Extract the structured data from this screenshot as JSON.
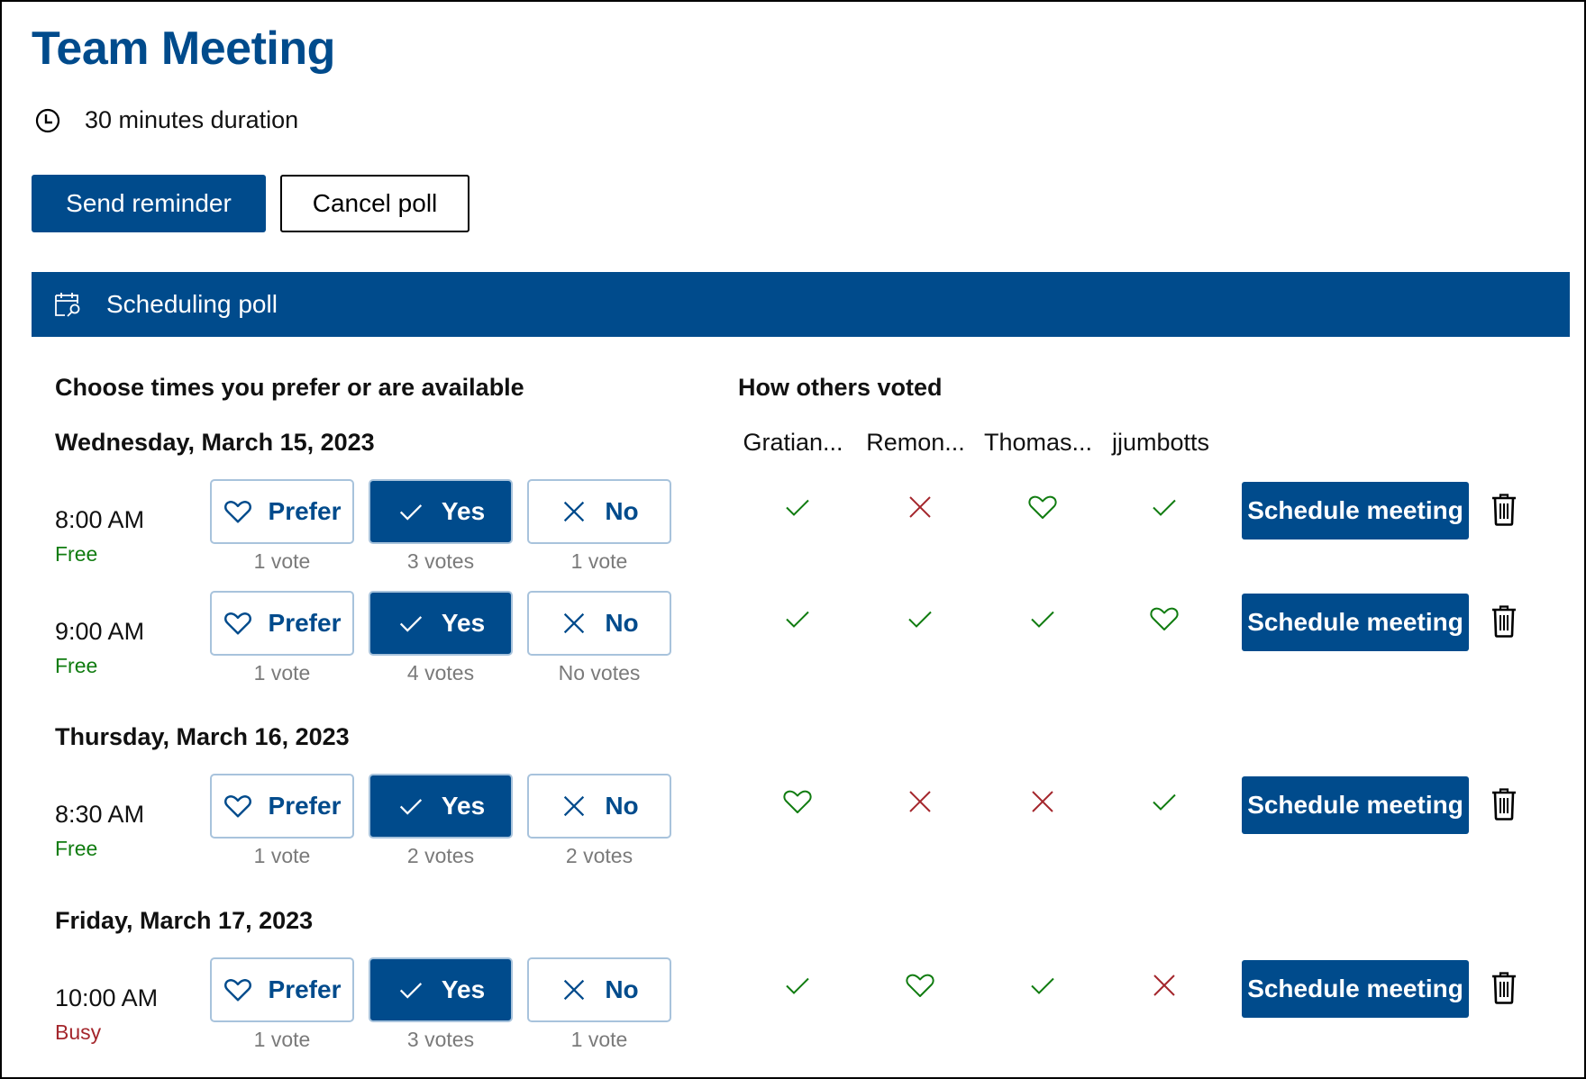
{
  "header": {
    "title": "Team Meeting",
    "duration": "30 minutes duration",
    "duration_icon": "clock-icon"
  },
  "actions": {
    "send_reminder": "Send reminder",
    "cancel_poll": "Cancel poll"
  },
  "banner": {
    "icon": "calendar-search-icon",
    "label": "Scheduling poll"
  },
  "left_heading": "Choose times you prefer or are available",
  "right_heading": "How others voted",
  "participants": [
    "Gratian...",
    "Remon...",
    "Thomas...",
    "jjumbotts"
  ],
  "labels": {
    "prefer": "Prefer",
    "yes": "Yes",
    "no": "No",
    "schedule": "Schedule meeting"
  },
  "colors": {
    "brand": "#004b8c",
    "free": "#107c10",
    "busy": "#a4262c",
    "vote_yes": "#107c10",
    "vote_prefer": "#107c10",
    "vote_no": "#a4262c"
  },
  "dates": [
    {
      "label": "Wednesday, March 15, 2023",
      "slots": [
        {
          "time": "8:00 AM",
          "status": "Free",
          "selected": "yes",
          "counts": {
            "prefer": "1 vote",
            "yes": "3 votes",
            "no": "1 vote"
          },
          "others": [
            "yes",
            "no",
            "prefer",
            "yes"
          ]
        },
        {
          "time": "9:00 AM",
          "status": "Free",
          "selected": "yes",
          "counts": {
            "prefer": "1 vote",
            "yes": "4 votes",
            "no": "No votes"
          },
          "others": [
            "yes",
            "yes",
            "yes",
            "prefer"
          ]
        }
      ]
    },
    {
      "label": "Thursday, March 16, 2023",
      "slots": [
        {
          "time": "8:30 AM",
          "status": "Free",
          "selected": "yes",
          "counts": {
            "prefer": "1 vote",
            "yes": "2 votes",
            "no": "2 votes"
          },
          "others": [
            "prefer",
            "no",
            "no",
            "yes"
          ]
        }
      ]
    },
    {
      "label": "Friday, March 17, 2023",
      "slots": [
        {
          "time": "10:00 AM",
          "status": "Busy",
          "selected": "yes",
          "counts": {
            "prefer": "1 vote",
            "yes": "3 votes",
            "no": "1 vote"
          },
          "others": [
            "yes",
            "prefer",
            "yes",
            "no"
          ]
        }
      ]
    }
  ]
}
